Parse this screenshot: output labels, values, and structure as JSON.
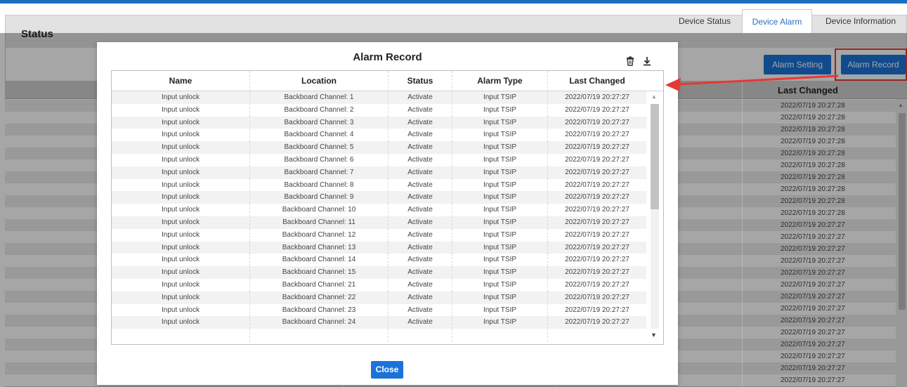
{
  "panel": {
    "title": "Status"
  },
  "tabs": [
    {
      "label": "Device Status",
      "active": false
    },
    {
      "label": "Device Alarm",
      "active": true
    },
    {
      "label": "Device Information",
      "active": false
    }
  ],
  "toolbar": {
    "alarm_setting": "Alarm Setting",
    "alarm_record": "Alarm Record"
  },
  "background_table": {
    "last_changed_header": "Last Changed",
    "dates": [
      "2022/07/19 20:27:28",
      "2022/07/19 20:27:28",
      "2022/07/19 20:27:28",
      "2022/07/19 20:27:28",
      "2022/07/19 20:27:28",
      "2022/07/19 20:27:28",
      "2022/07/19 20:27:28",
      "2022/07/19 20:27:28",
      "2022/07/19 20:27:28",
      "2022/07/19 20:27:28",
      "2022/07/19 20:27:27",
      "2022/07/19 20:27:27",
      "2022/07/19 20:27:27",
      "2022/07/19 20:27:27",
      "2022/07/19 20:27:27",
      "2022/07/19 20:27:27",
      "2022/07/19 20:27:27",
      "2022/07/19 20:27:27",
      "2022/07/19 20:27:27",
      "2022/07/19 20:27:27",
      "2022/07/19 20:27:27",
      "2022/07/19 20:27:27",
      "2022/07/19 20:27:27",
      "2022/07/19 20:27:27"
    ]
  },
  "modal": {
    "title": "Alarm Record",
    "icons": {
      "delete": "trash-icon",
      "download": "download-icon"
    },
    "columns": [
      "Name",
      "Location",
      "Status",
      "Alarm Type",
      "Last Changed"
    ],
    "rows": [
      [
        "Input unlock",
        "Backboard Channel: 1",
        "Activate",
        "Input TSIP",
        "2022/07/19 20:27:27"
      ],
      [
        "Input unlock",
        "Backboard Channel: 2",
        "Activate",
        "Input TSIP",
        "2022/07/19 20:27:27"
      ],
      [
        "Input unlock",
        "Backboard Channel: 3",
        "Activate",
        "Input TSIP",
        "2022/07/19 20:27:27"
      ],
      [
        "Input unlock",
        "Backboard Channel: 4",
        "Activate",
        "Input TSIP",
        "2022/07/19 20:27:27"
      ],
      [
        "Input unlock",
        "Backboard Channel: 5",
        "Activate",
        "Input TSIP",
        "2022/07/19 20:27:27"
      ],
      [
        "Input unlock",
        "Backboard Channel: 6",
        "Activate",
        "Input TSIP",
        "2022/07/19 20:27:27"
      ],
      [
        "Input unlock",
        "Backboard Channel: 7",
        "Activate",
        "Input TSIP",
        "2022/07/19 20:27:27"
      ],
      [
        "Input unlock",
        "Backboard Channel: 8",
        "Activate",
        "Input TSIP",
        "2022/07/19 20:27:27"
      ],
      [
        "Input unlock",
        "Backboard Channel: 9",
        "Activate",
        "Input TSIP",
        "2022/07/19 20:27:27"
      ],
      [
        "Input unlock",
        "Backboard Channel: 10",
        "Activate",
        "Input TSIP",
        "2022/07/19 20:27:27"
      ],
      [
        "Input unlock",
        "Backboard Channel: 11",
        "Activate",
        "Input TSIP",
        "2022/07/19 20:27:27"
      ],
      [
        "Input unlock",
        "Backboard Channel: 12",
        "Activate",
        "Input TSIP",
        "2022/07/19 20:27:27"
      ],
      [
        "Input unlock",
        "Backboard Channel: 13",
        "Activate",
        "Input TSIP",
        "2022/07/19 20:27:27"
      ],
      [
        "Input unlock",
        "Backboard Channel: 14",
        "Activate",
        "Input TSIP",
        "2022/07/19 20:27:27"
      ],
      [
        "Input unlock",
        "Backboard Channel: 15",
        "Activate",
        "Input TSIP",
        "2022/07/19 20:27:27"
      ],
      [
        "Input unlock",
        "Backboard Channel: 21",
        "Activate",
        "Input TSIP",
        "2022/07/19 20:27:27"
      ],
      [
        "Input unlock",
        "Backboard Channel: 22",
        "Activate",
        "Input TSIP",
        "2022/07/19 20:27:27"
      ],
      [
        "Input unlock",
        "Backboard Channel: 23",
        "Activate",
        "Input TSIP",
        "2022/07/19 20:27:27"
      ],
      [
        "Input unlock",
        "Backboard Channel: 24",
        "Activate",
        "Input TSIP",
        "2022/07/19 20:27:27"
      ]
    ],
    "close_label": "Close"
  },
  "colors": {
    "accent": "#1a73d9",
    "highlight": "#e53935",
    "top_bar": "#1a6fc0"
  }
}
